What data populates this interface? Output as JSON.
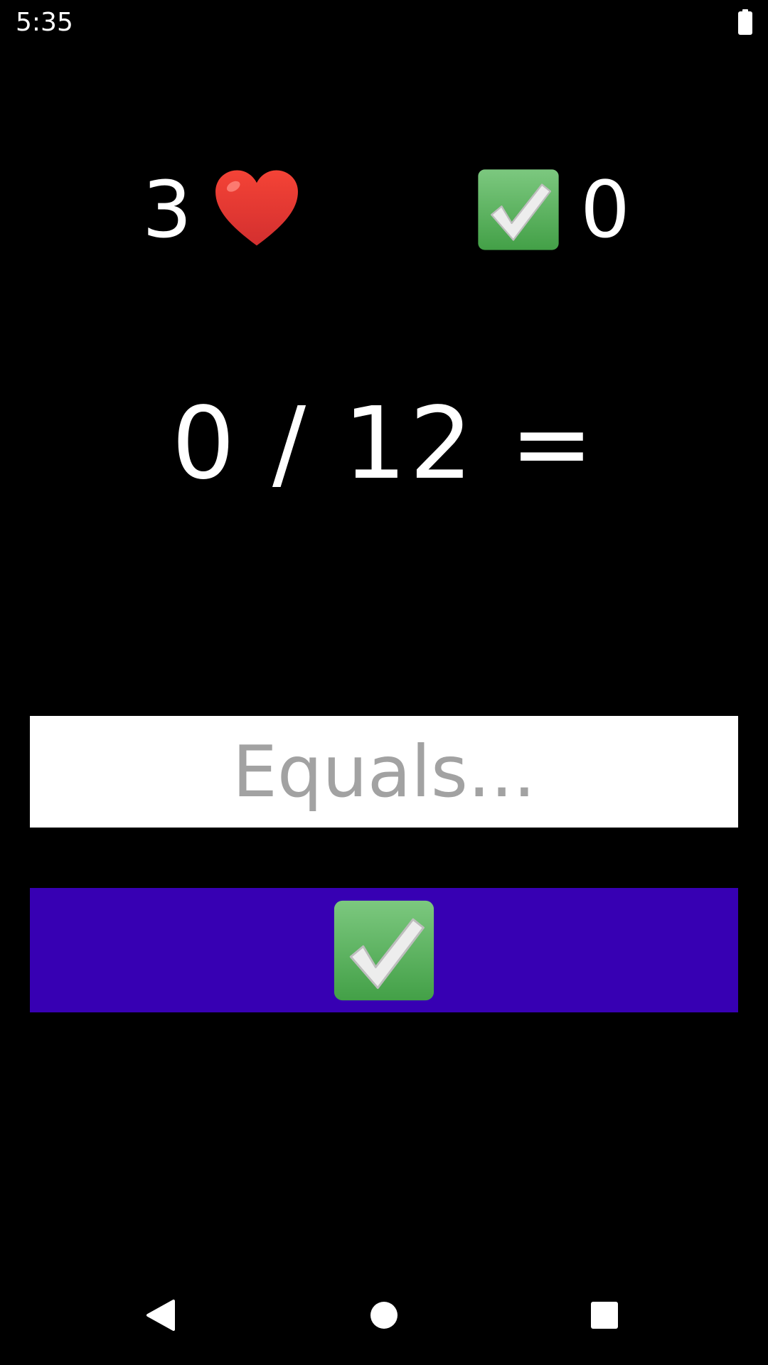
{
  "status_bar": {
    "time": "5:35",
    "battery_icon": "battery-full-icon"
  },
  "scoreboard": {
    "lives": "3",
    "lives_icon": "heart-icon",
    "correct": "0",
    "correct_icon": "check-mark-button-icon"
  },
  "question": {
    "equation": "0 / 12 ="
  },
  "answer": {
    "placeholder": "Equals...",
    "value": ""
  },
  "submit": {
    "icon": "check-mark-button-icon"
  },
  "nav_bar": {
    "back_icon": "back-triangle-icon",
    "home_icon": "home-circle-icon",
    "recents_icon": "recents-square-icon"
  },
  "colors": {
    "background": "#000000",
    "button": "#3700b3",
    "check_green": "#5cb85c",
    "heart_red": "#e53935",
    "placeholder": "#a2a2a2"
  }
}
